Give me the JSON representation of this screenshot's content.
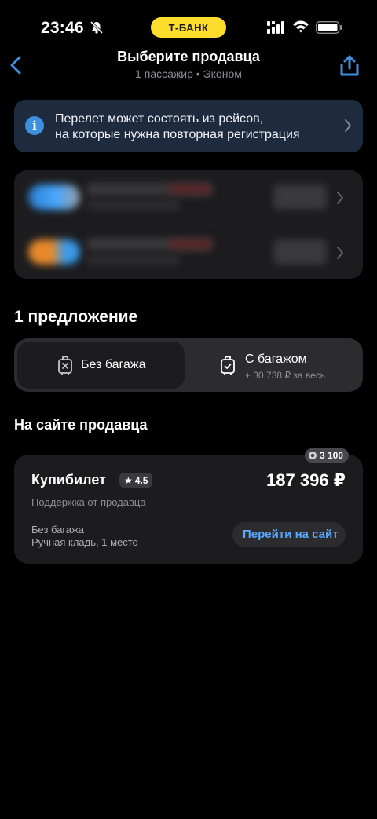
{
  "status": {
    "time": "23:46",
    "bank_badge": "Т-БАНК"
  },
  "nav": {
    "title": "Выберите продавца",
    "subtitle": "1 пассажир • Эконом"
  },
  "notice": {
    "line1": "Перелет может состоять из рейсов,",
    "line2": "на которые нужна повторная регистрация"
  },
  "offers": {
    "title": "1 предложение"
  },
  "baggage_toggle": {
    "without": "Без багажа",
    "with": "С багажом",
    "with_extra": "+ 30 738 ₽ за весь"
  },
  "seller_section": {
    "title": "На сайте продавца"
  },
  "seller": {
    "name": "Купибилет",
    "rating": "4.5",
    "price": "187 396 ₽",
    "support": "Поддержка от продавца",
    "bonus": "3 100",
    "baggage": "Без багажа",
    "hand_luggage": "Ручная кладь, 1 место",
    "go_button": "Перейти на сайт"
  },
  "colors": {
    "accent": "#3d8fe0",
    "link": "#5aa7ff",
    "bank_yellow": "#ffdd2d"
  }
}
